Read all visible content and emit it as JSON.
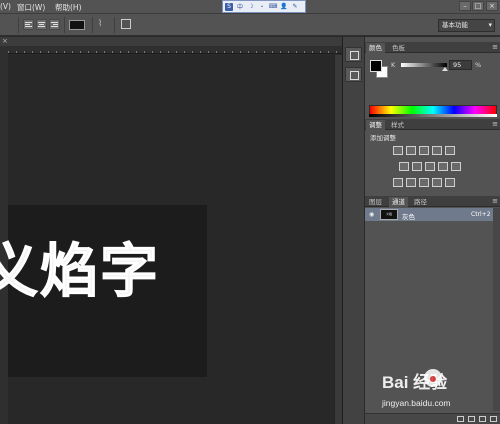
{
  "menubar": {
    "view": "(V)",
    "window": "窗口(W)",
    "help": "帮助(H)",
    "ime": {
      "logo": "S",
      "mode": "中",
      "punct": "・",
      "moon": "☽",
      "keyboard": "⌨",
      "user": "👤",
      "tool": "✎"
    }
  },
  "options": {
    "workspace": "基本功能",
    "text_color": "#111111"
  },
  "canvas": {
    "text": "义焰字"
  },
  "color_panel": {
    "tabs": [
      "颜色",
      "色板"
    ],
    "channel_label": "K",
    "channel_value": "95",
    "channel_unit": "%",
    "k_slider_level": 0.95
  },
  "adjustments_panel": {
    "tabs": [
      "调整",
      "样式"
    ],
    "title": "添加调整"
  },
  "layers_panel": {
    "tabs": [
      "图层",
      "通道",
      "路径"
    ],
    "channel": {
      "name": "灰色",
      "shortcut": "Ctrl+2",
      "thumb_label": "义焰"
    }
  },
  "watermark": {
    "brand": "Bai  经验",
    "site": "jingyan.baidu.com"
  }
}
